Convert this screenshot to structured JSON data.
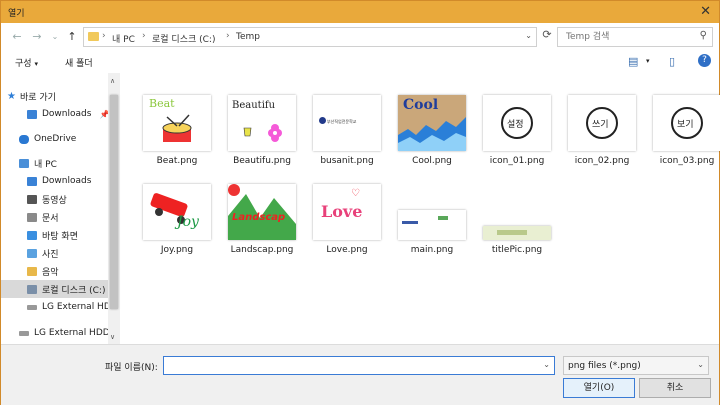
{
  "window": {
    "title": "열기"
  },
  "address": {
    "crumbs": [
      "내 PC",
      "로컬 디스크 (C:)",
      "Temp"
    ]
  },
  "search": {
    "placeholder": "Temp 검색"
  },
  "toolbar": {
    "organize_label": "구성",
    "new_folder_label": "새 폴더"
  },
  "sidebar": {
    "items": [
      {
        "label": "바로 가기"
      },
      {
        "label": "Downloads"
      },
      {
        "label": "OneDrive"
      },
      {
        "label": "내 PC"
      },
      {
        "label": "Downloads"
      },
      {
        "label": "동영상"
      },
      {
        "label": "문서"
      },
      {
        "label": "바탕 화면"
      },
      {
        "label": "사진"
      },
      {
        "label": "음악"
      },
      {
        "label": "로컬 디스크 (C:)"
      },
      {
        "label": "LG External HDD"
      },
      {
        "label": "LG External HDD"
      }
    ]
  },
  "files": [
    {
      "name": "Beat.png",
      "thumb_text": "Beat"
    },
    {
      "name": "Beautifu.png",
      "thumb_text": "Beautifu"
    },
    {
      "name": "busanit.png",
      "thumb_text": "부산직업전문학교"
    },
    {
      "name": "Cool.png",
      "thumb_text": "Cool"
    },
    {
      "name": "icon_01.png",
      "thumb_text": "설정"
    },
    {
      "name": "icon_02.png",
      "thumb_text": "쓰기"
    },
    {
      "name": "icon_03.png",
      "thumb_text": "보기"
    },
    {
      "name": "Joy.png",
      "thumb_text": "Joy"
    },
    {
      "name": "Landscap.png",
      "thumb_text": "Landscap"
    },
    {
      "name": "Love.png",
      "thumb_text": "Love"
    },
    {
      "name": "main.png",
      "thumb_text": ""
    },
    {
      "name": "titlePic.png",
      "thumb_text": ""
    }
  ],
  "bottom": {
    "filename_label": "파일 이름(N):",
    "filename_value": "",
    "filetype_value": "png files (*.png)",
    "open_label": "열기(O)",
    "cancel_label": "취소"
  },
  "colors": {
    "titlebar": "#e9a93b",
    "accent": "#3a7bd5"
  }
}
